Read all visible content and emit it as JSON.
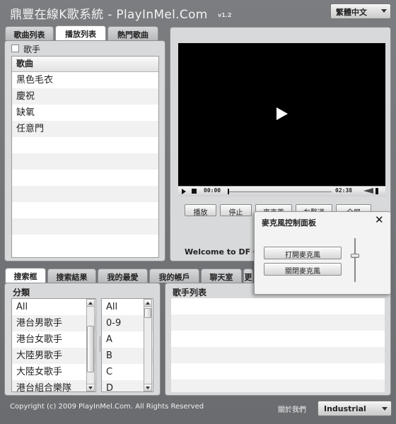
{
  "header": {
    "title": "鼎豐在線K歌系統 - PlayInMel.Com",
    "version": "v1.2",
    "language_select": "繁體中文"
  },
  "playlist_panel": {
    "tabs": [
      "歌曲列表",
      "播放列表",
      "熱門歌曲"
    ],
    "active_tab": "播放列表",
    "singer_checkbox_label": "歌手",
    "column_header": "歌曲",
    "songs": [
      "黑色毛衣",
      "慶祝",
      "缺氧",
      "任意門",
      "",
      "",
      "",
      "",
      "",
      "",
      ""
    ]
  },
  "player": {
    "time_current": "00:00",
    "time_total": "02:38",
    "buttons": [
      "播放",
      "停止",
      "麥克風",
      "左聲道",
      "全屏"
    ],
    "welcome_text": "Welcome to DF Onli"
  },
  "mic_panel": {
    "title": "麥克風控制面板",
    "open_button": "打開麥克風",
    "close_button": "關閉麥克風",
    "volume_level": 0.6
  },
  "search_panel": {
    "tabs": [
      "搜索框",
      "搜索結果",
      "我的最愛",
      "我的帳戶",
      "聊天室",
      "更"
    ],
    "active_tab": "搜索框",
    "category_header": "分類",
    "categories": [
      "All",
      "港台男歌手",
      "港台女歌手",
      "大陸男歌手",
      "大陸女歌手",
      "港台組合樂隊"
    ],
    "letters": [
      "All",
      "0-9",
      "A",
      "B",
      "C",
      "D"
    ],
    "singer_list_header": "歌手列表",
    "singers": [
      "",
      "",
      "",
      "",
      "",
      ""
    ]
  },
  "footer": {
    "copyright": "Copyright (c) 2009 PlayInMel.Com. All Rights Reserved",
    "about_link": "關於我們",
    "theme_select": "Industrial"
  }
}
